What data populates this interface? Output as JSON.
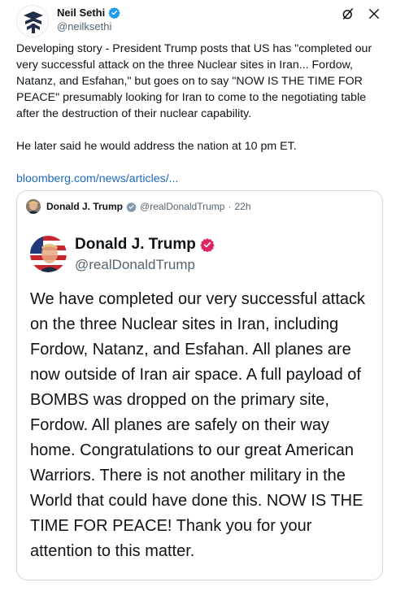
{
  "post": {
    "author_name": "Neil Sethi",
    "author_handle": "@neilksethi",
    "paragraphs": [
      "Developing story - President Trump posts that US has \"completed our very successful attack on the three Nuclear sites in Iran... Fordow, Natanz, and Esfahan,\" but goes on to say \"NOW IS THE TIME FOR PEACE\" presumably looking for Iran to come to the negotiating table after the destruction of their nuclear capability.",
      "He later said he would address the nation at 10 pm ET."
    ],
    "link_text": "bloomberg.com/news/articles/..."
  },
  "quote": {
    "author_name": "Donald J. Trump",
    "author_handle": "@realDonaldTrump",
    "separator": "·",
    "time": "22h",
    "embed": {
      "name": "Donald J. Trump",
      "handle": "@realDonaldTrump",
      "text": "We have completed our very successful attack on the three Nuclear sites in Iran, including Fordow, Natanz, and Esfahan. All planes are now outside of Iran air space. A full payload of BOMBS was dropped on the primary site, Fordow. All planes are safely on their way home. Congratulations to our great American Warriors. There is not another military in the World that could have done this. NOW IS THE TIME FOR PEACE! Thank you for your attention to this matter."
    }
  },
  "colors": {
    "link": "#1d6ac1",
    "verified_blue": "#1d9bf0",
    "verified_red": "#e0245e",
    "muted_text": "#536471",
    "border": "#cfd9de"
  },
  "icons": [
    "verified-badge-icon",
    "grok-icon",
    "close-icon",
    "gray-verified-badge-icon",
    "red-verified-badge-icon"
  ]
}
